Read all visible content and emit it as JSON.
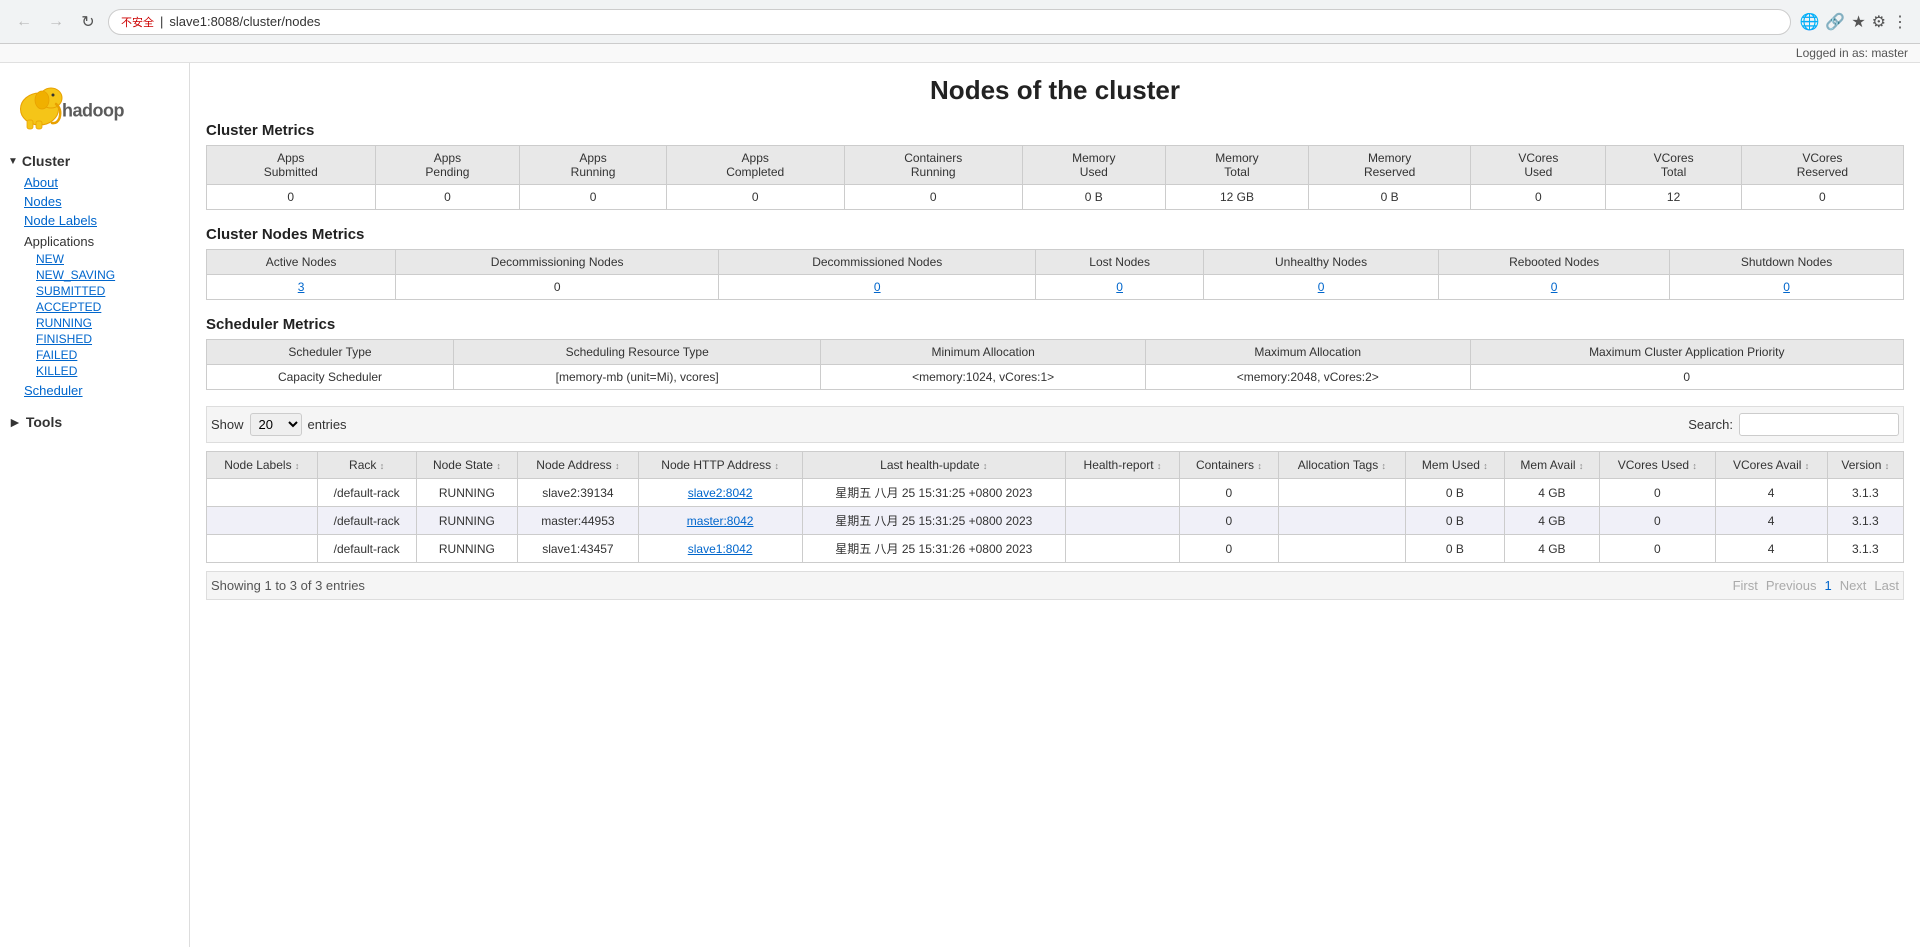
{
  "browser": {
    "back_disabled": true,
    "forward_disabled": true,
    "url": "slave1:8088/cluster/nodes",
    "warning": "不安全",
    "logged_in": "Logged in as: master"
  },
  "page": {
    "title": "Nodes of the cluster"
  },
  "sidebar": {
    "cluster_label": "Cluster",
    "items": [
      {
        "label": "About",
        "key": "about"
      },
      {
        "label": "Nodes",
        "key": "nodes"
      },
      {
        "label": "Node Labels",
        "key": "node-labels"
      }
    ],
    "applications_label": "Applications",
    "app_items": [
      {
        "label": "NEW",
        "key": "new"
      },
      {
        "label": "NEW_SAVING",
        "key": "new-saving"
      },
      {
        "label": "SUBMITTED",
        "key": "submitted"
      },
      {
        "label": "ACCEPTED",
        "key": "accepted"
      },
      {
        "label": "RUNNING",
        "key": "running"
      },
      {
        "label": "FINISHED",
        "key": "finished"
      },
      {
        "label": "FAILED",
        "key": "failed"
      },
      {
        "label": "KILLED",
        "key": "killed"
      }
    ],
    "scheduler_label": "Scheduler",
    "tools_label": "Tools"
  },
  "cluster_metrics": {
    "title": "Cluster Metrics",
    "headers": [
      "Apps Submitted",
      "Apps Pending",
      "Apps Running",
      "Apps Completed",
      "Containers Running",
      "Memory Used",
      "Memory Total",
      "Memory Reserved",
      "VCores Used",
      "VCores Total",
      "VCores Reserved"
    ],
    "values": [
      "0",
      "0",
      "0",
      "0",
      "0",
      "0 B",
      "12 GB",
      "0 B",
      "0",
      "12",
      "0"
    ]
  },
  "cluster_nodes_metrics": {
    "title": "Cluster Nodes Metrics",
    "headers": [
      "Active Nodes",
      "Decommissioning Nodes",
      "Decommissioned Nodes",
      "Lost Nodes",
      "Unhealthy Nodes",
      "Rebooted Nodes",
      "Shutdown Nodes"
    ],
    "values": [
      "3",
      "0",
      "0",
      "0",
      "0",
      "0",
      "0"
    ],
    "active_link": true
  },
  "scheduler_metrics": {
    "title": "Scheduler Metrics",
    "headers": [
      "Scheduler Type",
      "Scheduling Resource Type",
      "Minimum Allocation",
      "Maximum Allocation",
      "Maximum Cluster Application Priority"
    ],
    "values": [
      "Capacity Scheduler",
      "[memory-mb (unit=Mi), vcores]",
      "<memory:1024, vCores:1>",
      "<memory:2048, vCores:2>",
      "0"
    ]
  },
  "nodes_table": {
    "show_label": "Show",
    "show_value": "20",
    "entries_label": "entries",
    "search_label": "Search:",
    "search_value": "",
    "headers": [
      "Node Labels",
      "Rack",
      "Node State",
      "Node Address",
      "Node HTTP Address",
      "Last health-update",
      "Health-report",
      "Containers",
      "Allocation Tags",
      "Mem Used",
      "Mem Avail",
      "VCores Used",
      "VCores Avail",
      "Version"
    ],
    "rows": [
      {
        "node_labels": "",
        "rack": "/default-rack",
        "state": "RUNNING",
        "address": "slave2:39134",
        "http_address": "slave2:8042",
        "http_link": "slave2:8042",
        "last_health": "星期五 八月 25 15:31:25 +0800 2023",
        "health_report": "",
        "containers": "0",
        "alloc_tags": "",
        "mem_used": "0 B",
        "mem_avail": "4 GB",
        "vcores_used": "0",
        "vcores_avail": "4",
        "version": "3.1.3"
      },
      {
        "node_labels": "",
        "rack": "/default-rack",
        "state": "RUNNING",
        "address": "master:44953",
        "http_address": "master:8042",
        "http_link": "master:8042",
        "last_health": "星期五 八月 25 15:31:25 +0800 2023",
        "health_report": "",
        "containers": "0",
        "alloc_tags": "",
        "mem_used": "0 B",
        "mem_avail": "4 GB",
        "vcores_used": "0",
        "vcores_avail": "4",
        "version": "3.1.3"
      },
      {
        "node_labels": "",
        "rack": "/default-rack",
        "state": "RUNNING",
        "address": "slave1:43457",
        "http_address": "slave1:8042",
        "http_link": "slave1:8042",
        "last_health": "星期五 八月 25 15:31:26 +0800 2023",
        "health_report": "",
        "containers": "0",
        "alloc_tags": "",
        "mem_used": "0 B",
        "mem_avail": "4 GB",
        "vcores_used": "0",
        "vcores_avail": "4",
        "version": "3.1.3"
      }
    ],
    "showing_text": "Showing 1 to 3 of 3 entries",
    "pagination": [
      "First",
      "Previous",
      "1",
      "Next",
      "Last"
    ]
  }
}
